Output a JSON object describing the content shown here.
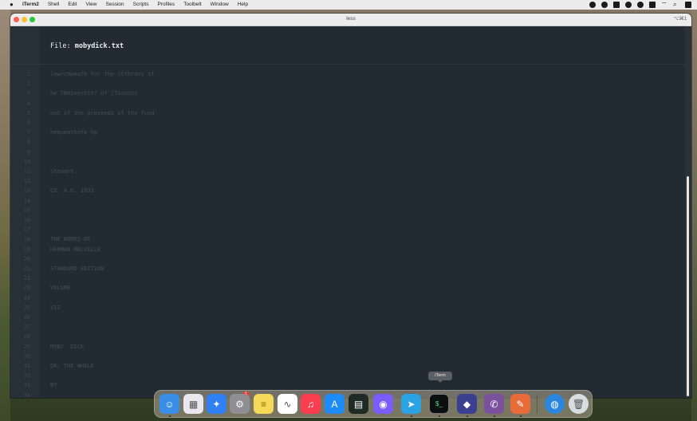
{
  "menubar": {
    "app": "iTerm2",
    "items": [
      "Shell",
      "Edit",
      "View",
      "Session",
      "Scripts",
      "Profiles",
      "Toolbelt",
      "Window",
      "Help"
    ]
  },
  "window": {
    "title": "less",
    "shortcut": "⌥⌘1"
  },
  "header": {
    "label": "File:",
    "filename": "mobydick.txt"
  },
  "lines": [
    {
      "n": "1",
      "t": "lowrchweafe for the Slthrary of"
    },
    {
      "n": "2",
      "t": ""
    },
    {
      "n": "3",
      "t": "he TWniverstt? of [Toronts"
    },
    {
      "n": "4",
      "t": ""
    },
    {
      "n": "5",
      "t": "out of the proceeds of the fund"
    },
    {
      "n": "6",
      "t": ""
    },
    {
      "n": "7",
      "t": "hequeathefe hp"
    },
    {
      "n": "8",
      "t": ""
    },
    {
      "n": "9",
      "t": ""
    },
    {
      "n": "10",
      "t": ""
    },
    {
      "n": "11",
      "t": "Stewart."
    },
    {
      "n": "12",
      "t": ""
    },
    {
      "n": "13",
      "t": "CD. A.D. 1932"
    },
    {
      "n": "14",
      "t": ""
    },
    {
      "n": "15",
      "t": ""
    },
    {
      "n": "16",
      "t": ""
    },
    {
      "n": "17",
      "t": ""
    },
    {
      "n": "18",
      "t": "THE WORKS OF"
    },
    {
      "n": "19",
      "t": "HERMAN MELVILLE"
    },
    {
      "n": "20",
      "t": ""
    },
    {
      "n": "21",
      "t": "STANDARD EDITION"
    },
    {
      "n": "22",
      "t": ""
    },
    {
      "n": "23",
      "t": "VOLUME"
    },
    {
      "n": "24",
      "t": ""
    },
    {
      "n": "25",
      "t": "VII"
    },
    {
      "n": "26",
      "t": ""
    },
    {
      "n": "27",
      "t": ""
    },
    {
      "n": "28",
      "t": ""
    },
    {
      "n": "29",
      "t": "MOBY  DICK"
    },
    {
      "n": "30",
      "t": ""
    },
    {
      "n": "31",
      "t": "OR, THE WHALE"
    },
    {
      "n": "32",
      "t": ""
    },
    {
      "n": "33",
      "t": "BY"
    },
    {
      "n": "34",
      "t": ""
    }
  ],
  "prompt": ":",
  "dock": {
    "tooltip": "iTerm",
    "badge": "1",
    "apps": [
      {
        "name": "finder",
        "color": "#3a8ee8",
        "glyph": "☺",
        "running": true
      },
      {
        "name": "launchpad",
        "color": "#e8e8ee",
        "glyph": "▦",
        "running": false
      },
      {
        "name": "safari",
        "color": "#2f7ff5",
        "glyph": "✦",
        "running": false
      },
      {
        "name": "system-settings",
        "color": "#8e8e93",
        "glyph": "⚙",
        "running": false
      },
      {
        "name": "notes",
        "color": "#f7d95a",
        "glyph": "≡",
        "running": false
      },
      {
        "name": "freeform",
        "color": "#ffffff",
        "glyph": "∿",
        "running": false
      },
      {
        "name": "music",
        "color": "#fb3d52",
        "glyph": "♫",
        "running": false
      },
      {
        "name": "app-store",
        "color": "#1d8cf8",
        "glyph": "A",
        "running": false
      },
      {
        "name": "activity-monitor",
        "color": "#1e2a23",
        "glyph": "▤",
        "running": false
      },
      {
        "name": "raycast",
        "color": "#7b5cff",
        "glyph": "◉",
        "running": false
      },
      {
        "name": "telegram",
        "color": "#2aa3e2",
        "glyph": "➤",
        "running": true
      },
      {
        "name": "iterm",
        "color": "#0b0f10",
        "glyph": "$_",
        "running": true
      },
      {
        "name": "shortcuts",
        "color": "#3b3f8f",
        "glyph": "◆",
        "running": true
      },
      {
        "name": "viber",
        "color": "#7b519d",
        "glyph": "✆",
        "running": true
      },
      {
        "name": "pixelmator",
        "color": "#e86b3a",
        "glyph": "✎",
        "running": true
      },
      {
        "name": "browser",
        "color": "#2b86e0",
        "glyph": "◍",
        "running": false
      },
      {
        "name": "trash",
        "color": "#d8dde2",
        "glyph": "🗑",
        "running": false
      }
    ]
  }
}
